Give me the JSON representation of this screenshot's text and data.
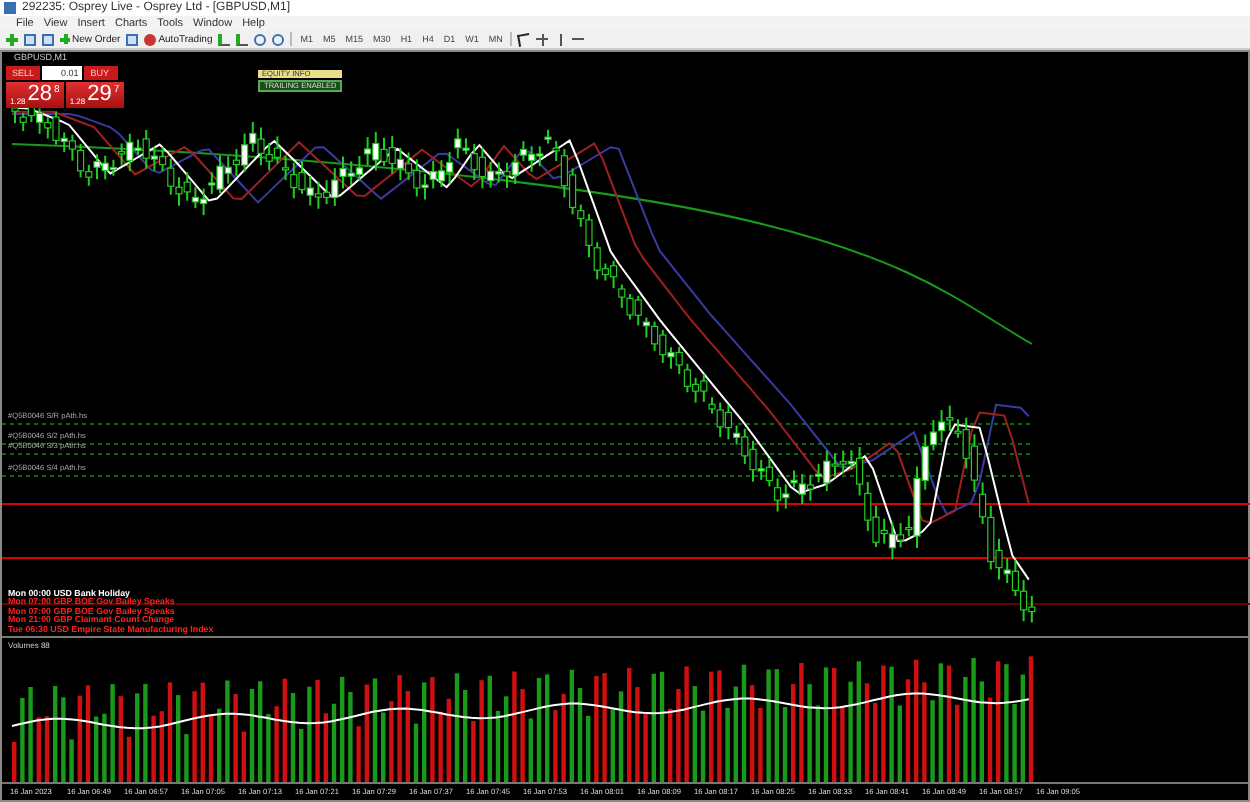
{
  "window": {
    "title": "292235: Osprey Live - Osprey Ltd - [GBPUSD,M1]"
  },
  "menu": [
    "File",
    "View",
    "Insert",
    "Charts",
    "Tools",
    "Window",
    "Help"
  ],
  "toolbar": {
    "new_order": "New Order",
    "autotrading": "AutoTrading",
    "timeframes": [
      "M1",
      "M5",
      "M15",
      "M30",
      "H1",
      "H4",
      "D1",
      "W1",
      "MN"
    ]
  },
  "chart_tab": {
    "title": "GBPUSD,M1"
  },
  "trade_panel": {
    "sell": "SELL",
    "buy": "BUY",
    "lot": "0.01",
    "sell_price": {
      "prefix": "1.28",
      "big": "28",
      "sup": "8"
    },
    "buy_price": {
      "prefix": "1.28",
      "big": "29",
      "sup": "7"
    }
  },
  "badges": [
    {
      "text": "EQUITY INFO",
      "kind": "info"
    },
    {
      "text": "TRAILING ENABLED",
      "kind": "status"
    }
  ],
  "levels": [
    "#Q5B0046 S/R pAth.hs",
    "#Q5B0046 S/2 pAth.hs",
    "#Q5B0046 S/3 pAth.hs",
    "#Q5B0046 S/4 pAth.hs"
  ],
  "events": [
    {
      "text": "Mon 00:00 USD Bank Holiday",
      "color": "#ffffff"
    },
    {
      "text": "Mon 07:00 GBP BOE Gov Bailey Speaks",
      "color": "#ff2020"
    },
    {
      "text": "Mon 07:00 GBP BOE Gov Bailey Speaks",
      "color": "#ff2020"
    },
    {
      "text": "Mon 21:00 GBP Claimant Count Change",
      "color": "#ff2020"
    },
    {
      "text": "Tue 06:30 USD Empire State Manufacturing Index",
      "color": "#ff2020"
    }
  ],
  "volume": {
    "label": "Volumes 88"
  },
  "x_axis": [
    "16 Jan 2023",
    "16 Jan 06:49",
    "16 Jan 06:57",
    "16 Jan 07:05",
    "16 Jan 07:13",
    "16 Jan 07:21",
    "16 Jan 07:29",
    "16 Jan 07:37",
    "16 Jan 07:45",
    "16 Jan 07:53",
    "16 Jan 08:01",
    "16 Jan 08:09",
    "16 Jan 08:17",
    "16 Jan 08:25",
    "16 Jan 08:33",
    "16 Jan 08:41",
    "16 Jan 08:49",
    "16 Jan 08:57",
    "16 Jan 09:05"
  ]
}
